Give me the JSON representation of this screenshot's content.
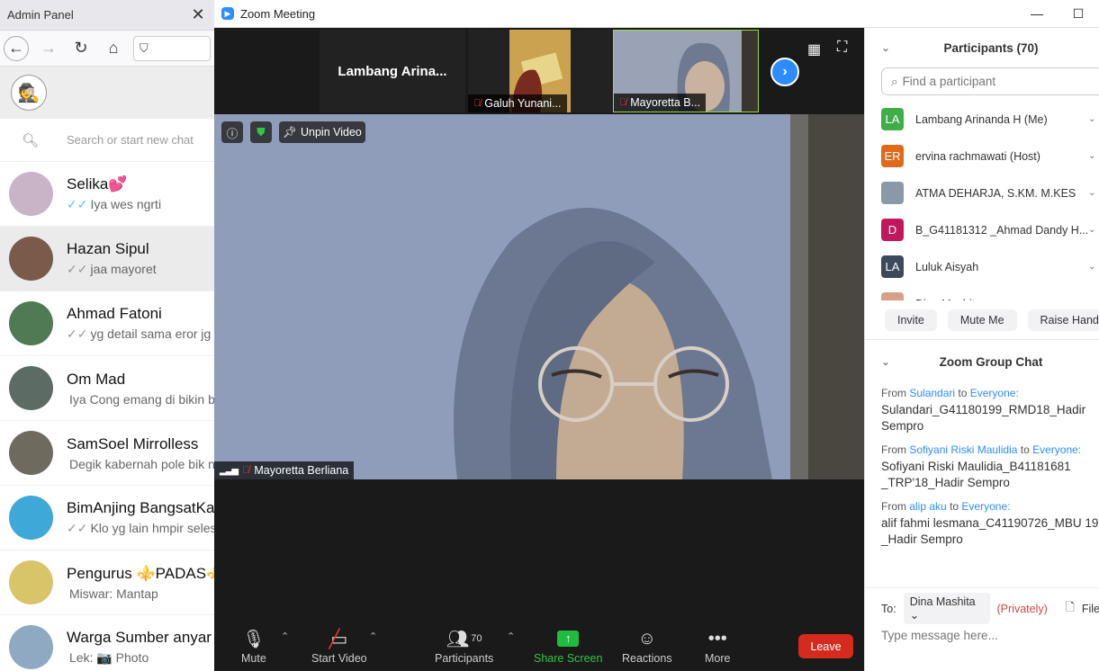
{
  "browser": {
    "tab_title": "Admin Panel",
    "tab_close": "✕",
    "search_placeholder": "Search or start new chat",
    "chats": [
      {
        "name": "Selika💕",
        "msg": "Iya  wes ngrti",
        "ticks": "✓✓",
        "tick_color": "blue",
        "avatar_color": "#c9b3c7"
      },
      {
        "name": "Hazan Sipul",
        "msg": "jaa mayoret",
        "ticks": "✓✓",
        "tick_color": "grey",
        "avatar_color": "#7a5a4a"
      },
      {
        "name": "Ahmad Fatoni",
        "msg": "yg detail sama eror jg",
        "ticks": "✓✓",
        "tick_color": "grey",
        "avatar_color": "#4f7a54"
      },
      {
        "name": "Om Mad",
        "msg": "Iya Cong emang di bikin bi",
        "ticks": "",
        "tick_color": "grey",
        "avatar_color": "#5c6b63"
      },
      {
        "name": "SamSoel Mirrolless",
        "msg": "Degik kabernah pole bik ng",
        "ticks": "",
        "tick_color": "grey",
        "avatar_color": "#6e6a5e"
      },
      {
        "name": "BimAnjing BangsatKar",
        "msg": "Klo yg lain hmpir selesa",
        "ticks": "✓✓",
        "tick_color": "grey",
        "avatar_color": "#3ea8d8"
      },
      {
        "name": "Pengurus ⚜️PADAS⚜️",
        "msg": "Miswar: Mantap",
        "ticks": "",
        "tick_color": "grey",
        "avatar_color": "#d8c56a"
      },
      {
        "name": "Warga Sumber anyar",
        "msg": "Lek: 📷 Photo",
        "ticks": "",
        "tick_color": "grey",
        "avatar_color": "#8fa9c2"
      }
    ]
  },
  "zoom": {
    "window_title": "Zoom Meeting",
    "strip_name": "Lambang  Arina...",
    "thumbs": [
      {
        "label": "Galuh Yunani..."
      },
      {
        "label": "Mayoretta B..."
      }
    ],
    "video": {
      "unpin_label": "Unpin Video",
      "speaker_name": "Mayoretta Berliana"
    },
    "controls": {
      "mute": "Mute",
      "start_video": "Start Video",
      "participants": "Participants",
      "participants_count": "70",
      "share_screen": "Share Screen",
      "reactions": "Reactions",
      "more": "More",
      "leave": "Leave"
    },
    "accent_color": "#2d8cff",
    "leave_color": "#d52b1e"
  },
  "panel": {
    "participants_title": "Participants (70)",
    "search_placeholder": "Find a participant",
    "participants": [
      {
        "initials": "LA",
        "name": "Lambang Arinanda H (Me)",
        "color": "#3fae49"
      },
      {
        "initials": "ER",
        "name": "ervina rachmawati (Host)",
        "color": "#e06a1b"
      },
      {
        "initials": "",
        "name": "ATMA DEHARJA, S.KM. M.KES",
        "color": "#8a99a8"
      },
      {
        "initials": "D",
        "name": "B_G41181312 _Ahmad Dandy H...",
        "color": "#c2185b"
      },
      {
        "initials": "LA",
        "name": "Luluk Aisyah",
        "color": "#3d4a5c"
      },
      {
        "initials": "",
        "name": "Dina Mashita",
        "color": "#d8a08a"
      }
    ],
    "actions": [
      "Invite",
      "Mute Me",
      "Raise Hand"
    ],
    "chat_title": "Zoom Group Chat",
    "messages": [
      {
        "from_label": "From",
        "sender": "Sulandari",
        "to_label": "to",
        "recipient": "Everyone:",
        "text": "Sulandari_G41180199_RMD18_Hadir Sempro"
      },
      {
        "from_label": "From",
        "sender": "Sofiyani Riski Maulidia",
        "to_label": "to",
        "recipient": "Everyone:",
        "text": "Sofiyani Riski Maulidia_B41181681 _TRP'18_Hadir Sempro"
      },
      {
        "from_label": "From",
        "sender": "alip aku",
        "to_label": "to",
        "recipient": "Everyone:",
        "text": "alif fahmi lesmana_C41190726_MBU 19 _Hadir Sempro"
      }
    ],
    "to_label": "To:",
    "to_value": "Dina Mashita ⌄",
    "privately": "(Privately)",
    "file_label": "File",
    "input_placeholder": "Type message here..."
  }
}
